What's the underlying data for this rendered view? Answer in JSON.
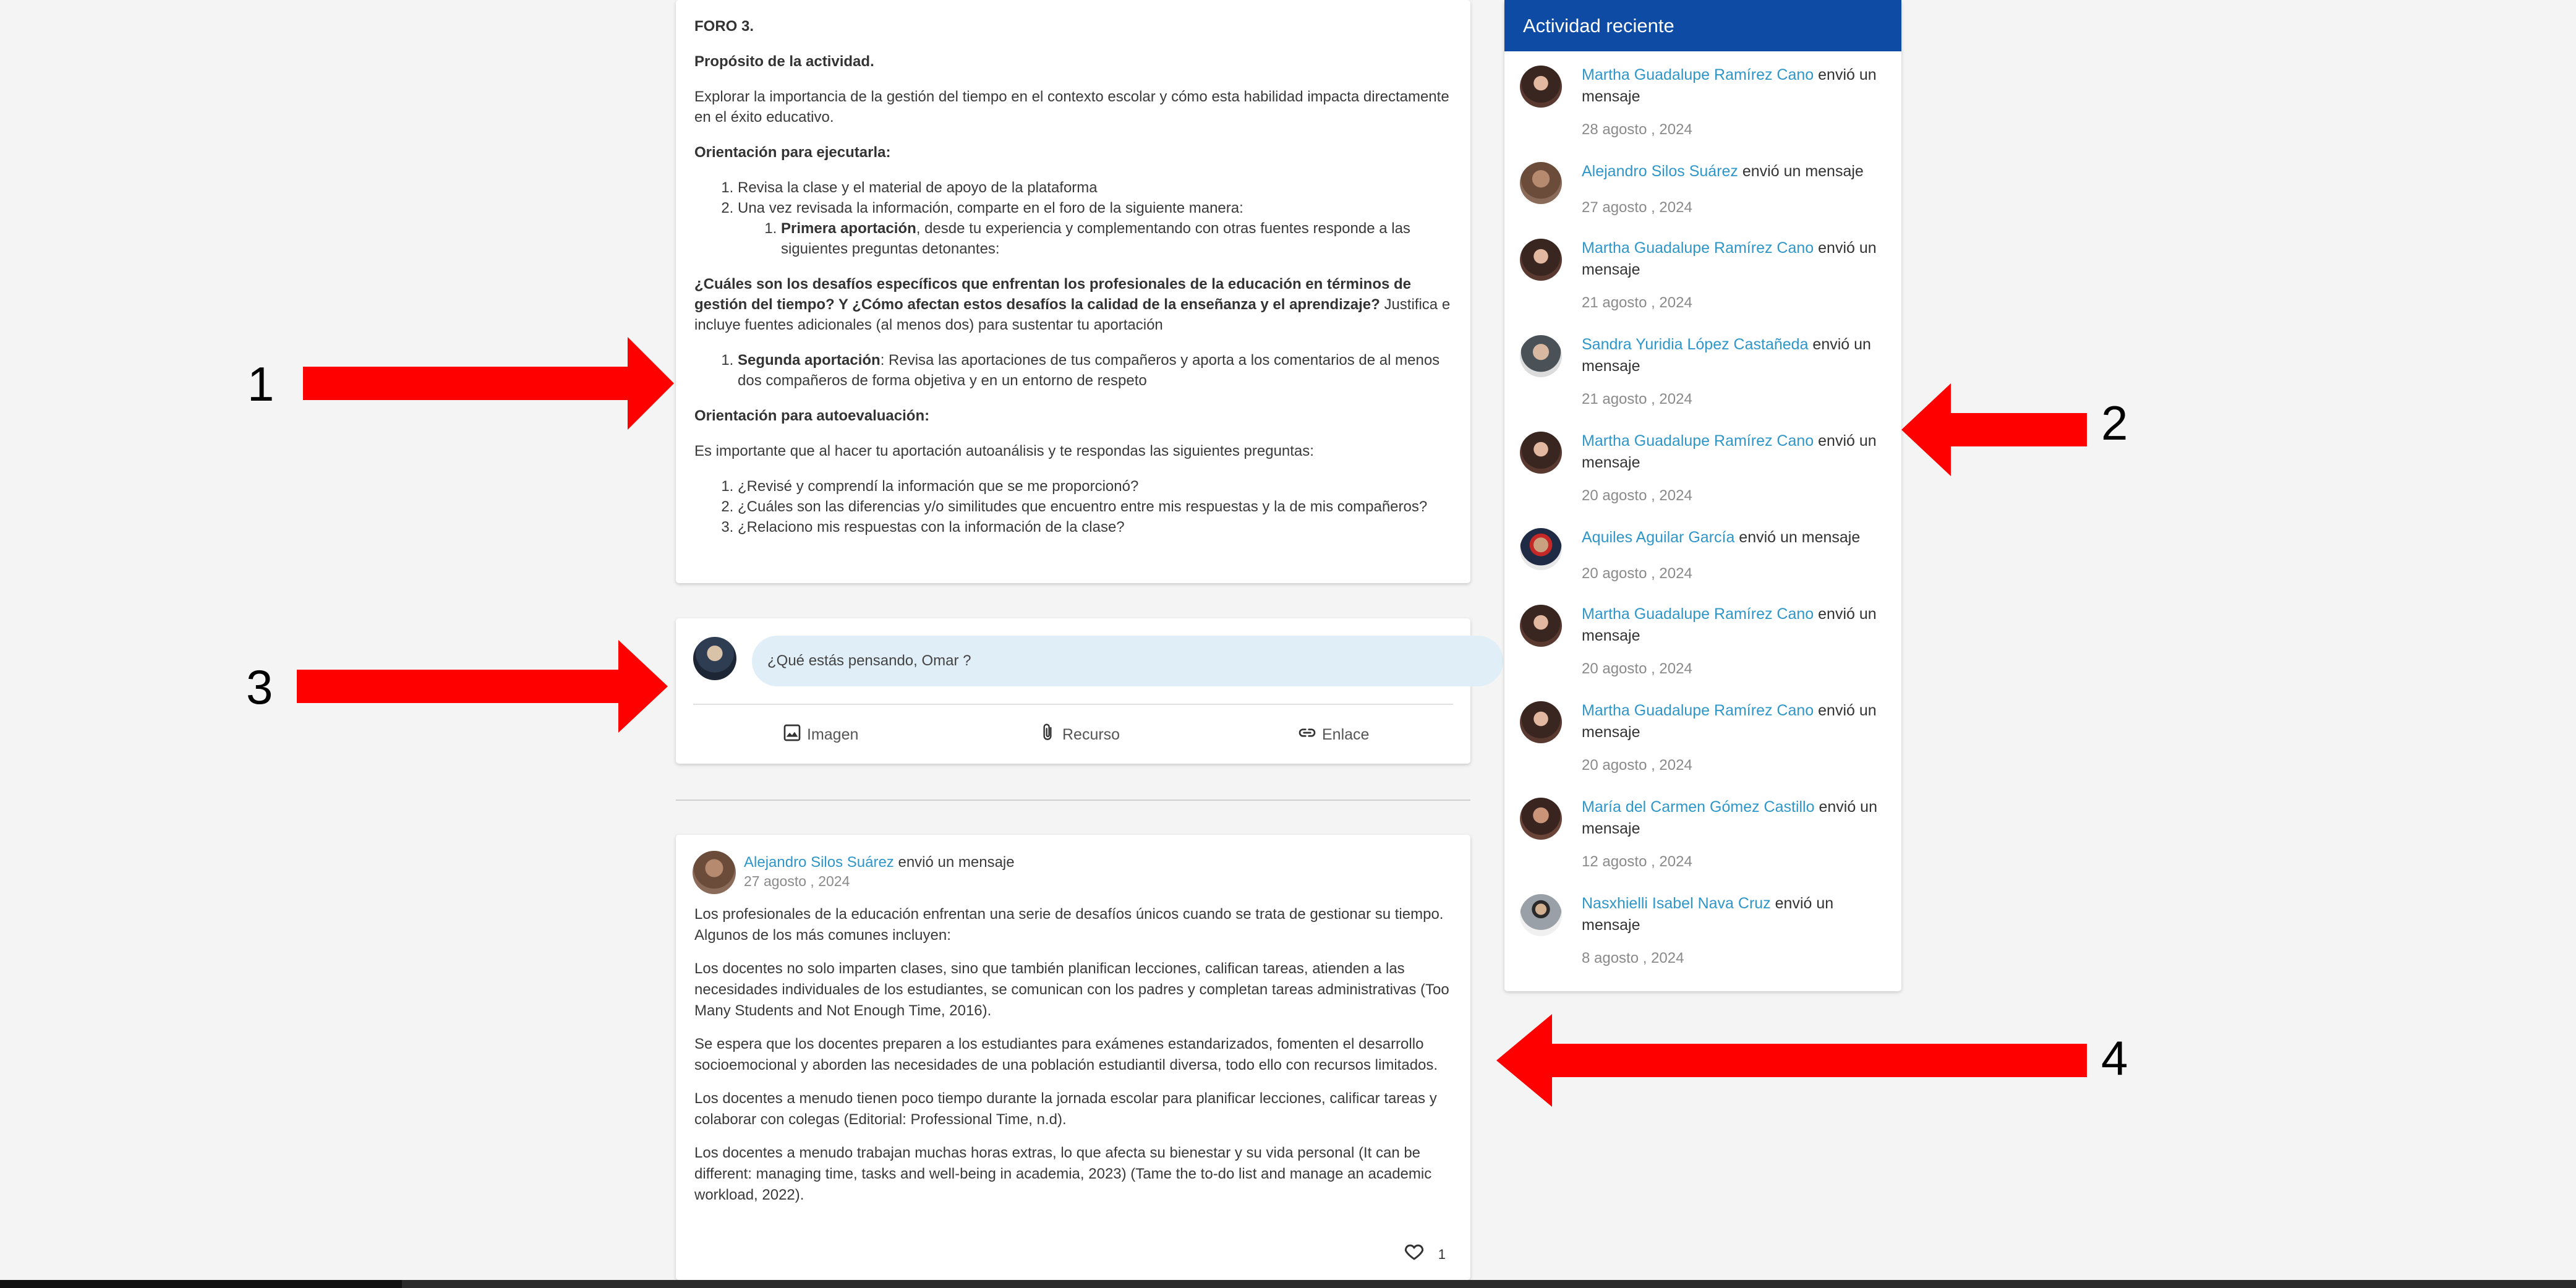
{
  "forum": {
    "title": "FORO 3.",
    "purpose_heading": "Propósito de la actividad.",
    "purpose_text": "Explorar la importancia de la gestión del tiempo en el contexto escolar y cómo esta habilidad impacta directamente en el éxito educativo.",
    "orientation_heading": "Orientación para ejecutarla:",
    "steps": [
      "Revisa la clase y el material de apoyo de la plataforma",
      "Una vez revisada la información, comparte en el foro de la siguiente manera:"
    ],
    "first_contribution_label": "Primera aportación",
    "first_contribution_text": ", desde tu experiencia y   complementando con otras fuentes responde a las siguientes preguntas detonantes:",
    "questions_bold": "¿Cuáles son los desafíos específicos que enfrentan los profesionales de la educación en términos de gestión del tiempo? Y ¿Cómo afectan estos desafíos la calidad de la enseñanza y el aprendizaje?",
    "questions_tail": " Justifica e incluye fuentes adicionales (al menos dos) para sustentar tu aportación",
    "second_contribution_label": "Segunda aportación",
    "second_contribution_text": ": Revisa las aportaciones de tus compañeros y aporta a los comentarios de al menos dos compañeros de forma objetiva y en un entorno de respeto",
    "self_eval_heading": "Orientación para autoevaluación:",
    "self_eval_intro": "Es importante que al hacer tu aportación autoanálisis y te respondas las siguientes preguntas:",
    "self_eval_questions": [
      "¿Revisé y comprendí la información que se me proporcionó?",
      "¿Cuáles son las diferencias y/o similitudes que encuentro entre mis respuestas y la de mis compañeros?",
      "¿Relaciono mis respuestas con la información de la clase?"
    ]
  },
  "composer": {
    "placeholder": "¿Qué estás pensando, Omar ?",
    "actions": {
      "image": "Imagen",
      "resource": "Recurso",
      "link": "Enlace"
    }
  },
  "post": {
    "author": "Alejandro Silos Suárez",
    "action": " envió un mensaje",
    "date": "27 agosto , 2024",
    "paragraphs": [
      "Los profesionales de la educación enfrentan una serie de desafíos únicos cuando se trata de gestionar su tiempo. Algunos de los más comunes incluyen:",
      "Los docentes no solo imparten clases, sino que también planifican lecciones, califican tareas, atienden a las necesidades individuales de los estudiantes, se comunican con los padres y completan tareas administrativas (Too Many Students and Not Enough Time, 2016).",
      "Se espera que los docentes preparen a los estudiantes para exámenes estandarizados, fomenten el desarrollo socioemocional y aborden las necesidades de una población estudiantil diversa, todo ello con recursos limitados.",
      "Los docentes a menudo tienen poco tiempo durante la jornada escolar para planificar lecciones, calificar tareas y colaborar con colegas (Editorial: Professional Time, n.d).",
      "Los docentes a menudo trabajan muchas horas extras, lo que afecta su bienestar y su vida personal (It can be different: managing time, tasks and well-being in academia, 2023) (Tame the to-do list and manage an academic workload, 2022)."
    ],
    "likes": "1"
  },
  "activity": {
    "header": "Actividad reciente",
    "action_text": " envió un mensaje",
    "items": [
      {
        "name": "Martha Guadalupe Ramírez Cano",
        "date": "28 agosto , 2024"
      },
      {
        "name": "Alejandro Silos Suárez",
        "date": "27 agosto , 2024"
      },
      {
        "name": "Martha Guadalupe Ramírez Cano",
        "date": "21 agosto , 2024"
      },
      {
        "name": "Sandra Yuridia López Castañeda",
        "date": "21 agosto , 2024"
      },
      {
        "name": "Martha Guadalupe Ramírez Cano",
        "date": "20 agosto , 2024"
      },
      {
        "name": "Aquiles Aguilar García",
        "date": "20 agosto , 2024"
      },
      {
        "name": "Martha Guadalupe Ramírez Cano",
        "date": "20 agosto , 2024"
      },
      {
        "name": "Martha Guadalupe Ramírez Cano",
        "date": "20 agosto , 2024"
      },
      {
        "name": "María del Carmen Gómez Castillo",
        "date": "12 agosto , 2024"
      },
      {
        "name": "Nasxhielli Isabel Nava Cruz",
        "date": "8 agosto , 2024"
      }
    ]
  },
  "annotations": [
    "1",
    "2",
    "3",
    "4"
  ],
  "colors": {
    "accent": "#0e4ba5",
    "link": "#2f96c9",
    "arrow": "#ff0000"
  },
  "icons": [
    "image-icon",
    "paperclip-icon",
    "link-icon",
    "heart-icon"
  ]
}
